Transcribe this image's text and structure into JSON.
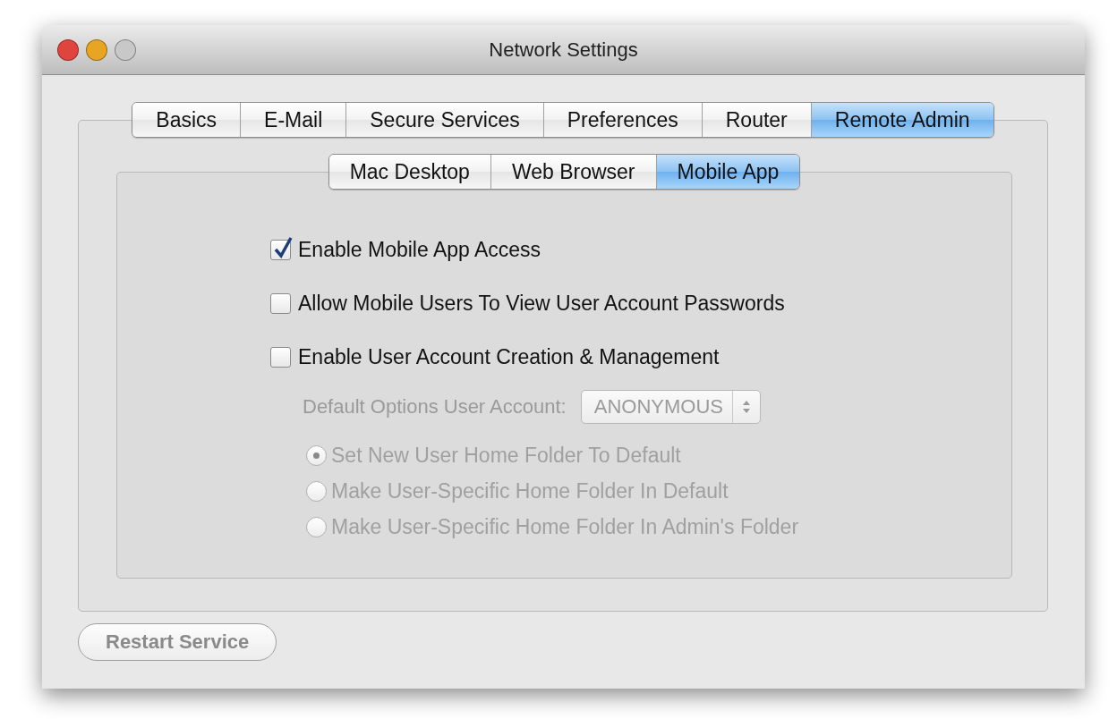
{
  "window": {
    "title": "Network Settings",
    "controls": [
      {
        "color": "#e0443e"
      },
      {
        "color": "#e8a524"
      },
      {
        "color": "#c8c8c8"
      }
    ]
  },
  "tabs": [
    {
      "label": "Basics",
      "selected": false
    },
    {
      "label": "E-Mail",
      "selected": false
    },
    {
      "label": "Secure Services",
      "selected": false
    },
    {
      "label": "Preferences",
      "selected": false
    },
    {
      "label": "Router",
      "selected": false
    },
    {
      "label": "Remote Admin",
      "selected": true
    }
  ],
  "subtabs": [
    {
      "label": "Mac Desktop",
      "selected": false
    },
    {
      "label": "Web Browser",
      "selected": false
    },
    {
      "label": "Mobile App",
      "selected": true
    }
  ],
  "checkboxes": [
    {
      "label": "Enable Mobile App Access",
      "checked": true
    },
    {
      "label": "Allow Mobile Users To View User Account Passwords",
      "checked": false
    },
    {
      "label": "Enable User Account Creation & Management",
      "checked": false
    }
  ],
  "account_options": {
    "disabled": true,
    "label": "Default Options User Account:",
    "popup": {
      "value": "ANONYMOUS"
    },
    "radios": [
      {
        "label": "Set New User Home Folder To Default",
        "selected": true
      },
      {
        "label": "Make User-Specific Home Folder In Default",
        "selected": false
      },
      {
        "label": "Make User-Specific Home Folder In Admin's Folder",
        "selected": false
      }
    ]
  },
  "restart_button": {
    "label": "Restart Service",
    "disabled": true
  }
}
